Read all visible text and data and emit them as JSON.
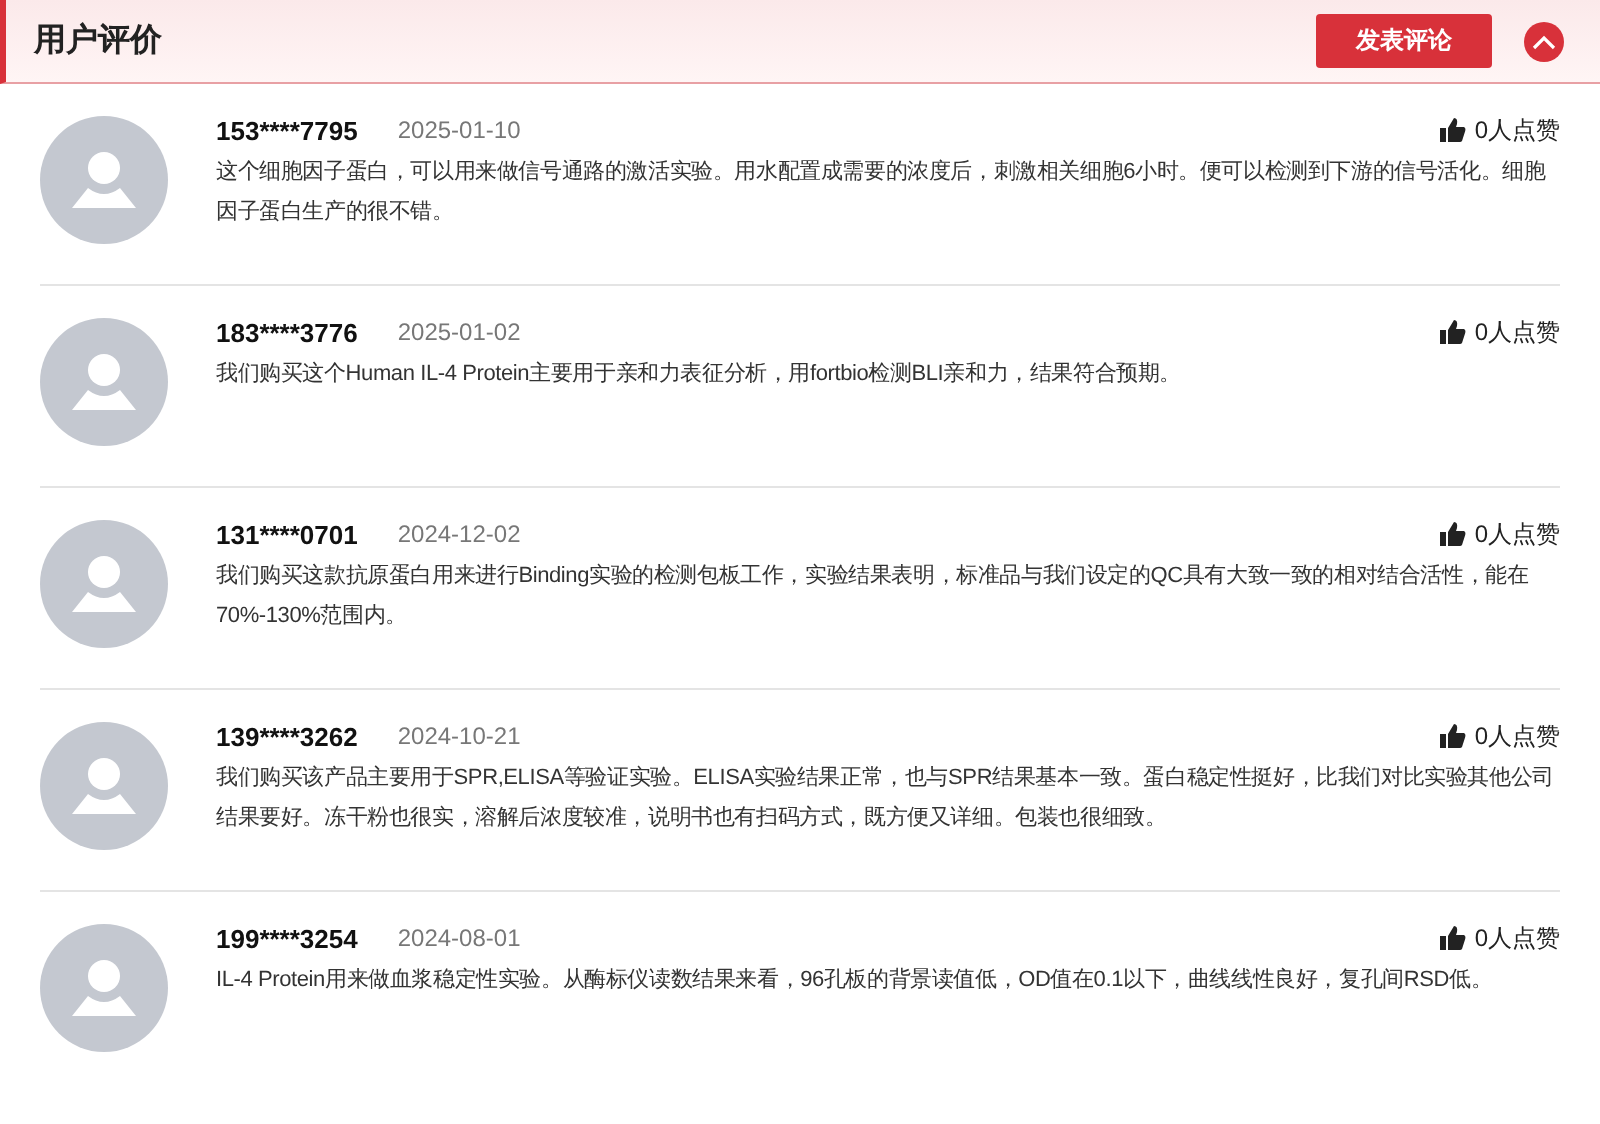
{
  "header": {
    "title": "用户评价",
    "post_button": "发表评论"
  },
  "reviews": [
    {
      "user": "153****7795",
      "date": "2025-01-10",
      "likes": "0人点赞",
      "text": "这个细胞因子蛋白，可以用来做信号通路的激活实验。用水配置成需要的浓度后，刺激相关细胞6小时。便可以检测到下游的信号活化。细胞因子蛋白生产的很不错。"
    },
    {
      "user": "183****3776",
      "date": "2025-01-02",
      "likes": "0人点赞",
      "text": "我们购买这个Human IL-4 Protein主要用于亲和力表征分析，用fortbio检测BLI亲和力，结果符合预期。"
    },
    {
      "user": "131****0701",
      "date": "2024-12-02",
      "likes": "0人点赞",
      "text": "我们购买这款抗原蛋白用来进行Binding实验的检测包板工作，实验结果表明，标准品与我们设定的QC具有大致一致的相对结合活性，能在70%-130%范围内。"
    },
    {
      "user": "139****3262",
      "date": "2024-10-21",
      "likes": "0人点赞",
      "text": "我们购买该产品主要用于SPR,ELISA等验证实验。ELISA实验结果正常，也与SPR结果基本一致。蛋白稳定性挺好，比我们对比实验其他公司结果要好。冻干粉也很实，溶解后浓度较准，说明书也有扫码方式，既方便又详细。包装也很细致。"
    },
    {
      "user": "199****3254",
      "date": "2024-08-01",
      "likes": "0人点赞",
      "text": "IL-4 Protein用来做血浆稳定性实验。从酶标仪读数结果来看，96孔板的背景读值低，OD值在0.1以下，曲线线性良好，复孔间RSD低。"
    }
  ]
}
